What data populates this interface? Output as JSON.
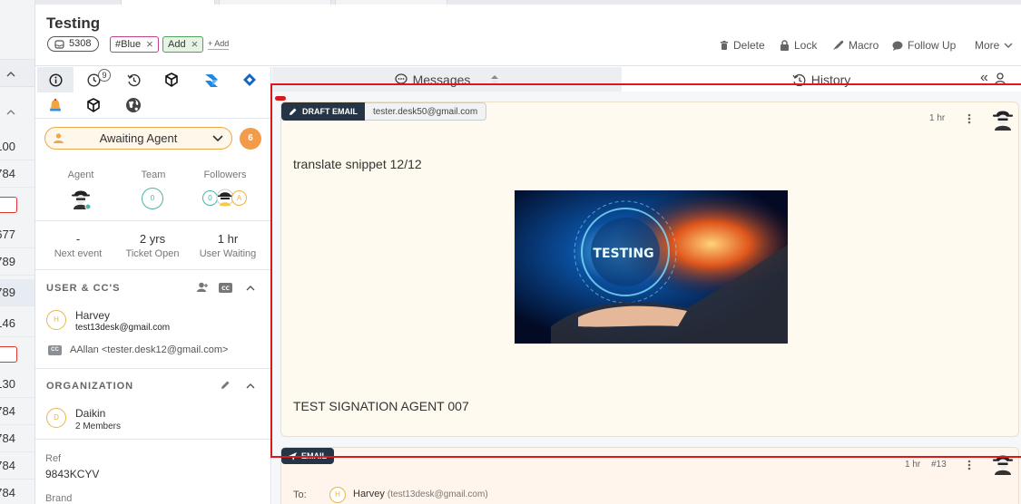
{
  "left_strip": {
    "rows": [
      "100",
      "784",
      "",
      "677",
      "789",
      "789",
      "146",
      "",
      "130",
      "784",
      "784",
      "784",
      "784"
    ]
  },
  "header": {
    "title": "Testing",
    "ticket_id": "5308",
    "tags": [
      {
        "label": "#Blue",
        "color": "#c2418c"
      },
      {
        "label": "Add",
        "color": "#4fa35a"
      }
    ],
    "add_tag_label": "+ Add",
    "actions": {
      "delete": "Delete",
      "lock": "Lock",
      "macro": "Macro",
      "follow_up": "Follow Up",
      "more": "More"
    }
  },
  "side_panel": {
    "tab_badge_count": "9",
    "status": {
      "label": "Awaiting Agent",
      "count": "6"
    },
    "people": {
      "agent_label": "Agent",
      "team_label": "Team",
      "team_count": "0",
      "followers_label": "Followers",
      "followers_count": "0",
      "followers_letter": "A"
    },
    "stats": [
      {
        "value": "-",
        "label": "Next event"
      },
      {
        "value": "2 yrs",
        "label": "Ticket Open"
      },
      {
        "value": "1 hr",
        "label": "User Waiting"
      }
    ],
    "users_section": {
      "title": "USER & CC'S",
      "user_initial": "H",
      "user_name": "Harvey",
      "user_email": "test13desk@gmail.com",
      "cc_badge": "CC",
      "cc_text": "AAllan <tester.desk12@gmail.com>"
    },
    "org_section": {
      "title": "ORGANIZATION",
      "org_initial": "D",
      "org_name": "Daikin",
      "org_members": "2 Members"
    },
    "ref": {
      "label": "Ref",
      "value": "9843KCYV"
    },
    "brand_label": "Brand"
  },
  "tabs": {
    "messages": "Messages",
    "history": "History",
    "collapse": "«"
  },
  "draft_message": {
    "badge": "DRAFT EMAIL",
    "from_email": "tester.desk50@gmail.com",
    "time": "1 hr",
    "body_text": "translate snippet 12/12",
    "image_text": "TESTING",
    "signature": "TEST SIGNATION AGENT 007"
  },
  "email_message": {
    "badge": "EMAIL",
    "time": "1 hr",
    "number": "#13",
    "to_label": "To:",
    "to_initial": "H",
    "to_name": "Harvey",
    "to_email": "(test13desk@gmail.com)"
  },
  "colors": {
    "accent_orange": "#f29b4b",
    "dark_badge": "#263545",
    "highlight_red": "#d9191b",
    "teal": "#4db3a5"
  }
}
